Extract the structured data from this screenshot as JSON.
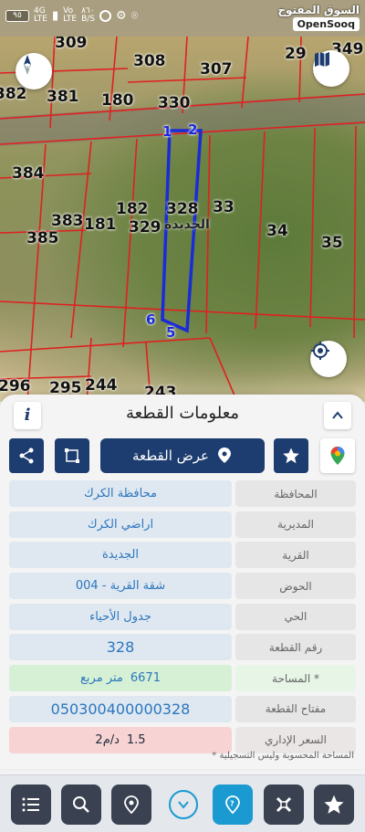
{
  "status_bar": {
    "battery": "٩٥",
    "net_top": "4G",
    "net_bottom": "LTE",
    "vo_top": "Vo",
    "vo_bottom": "LTE",
    "speed_top": "٨٦٠",
    "speed_bottom": "B/S"
  },
  "brand": {
    "arabic": "السوق المفتوح",
    "english": "OpenSooq"
  },
  "map": {
    "plots": [
      {
        "id": "309",
        "pos": "p1"
      },
      {
        "id": "308",
        "pos": "p2"
      },
      {
        "id": "307",
        "pos": "p3"
      },
      {
        "id": "29",
        "pos": "p4"
      },
      {
        "id": "349",
        "pos": "p5"
      },
      {
        "id": "382",
        "pos": "p6"
      },
      {
        "id": "381",
        "pos": "p7"
      },
      {
        "id": "180",
        "pos": "p8"
      },
      {
        "id": "330",
        "pos": "p9"
      },
      {
        "id": "384",
        "pos": "p10"
      },
      {
        "id": "182",
        "pos": "p11"
      },
      {
        "id": "328",
        "pos": "p12"
      },
      {
        "id": "33",
        "pos": "p13"
      },
      {
        "id": "383",
        "pos": "p14"
      },
      {
        "id": "181",
        "pos": "p15"
      },
      {
        "id": "329",
        "pos": "p16"
      },
      {
        "id": "385",
        "pos": "p17"
      },
      {
        "id": "34",
        "pos": "p18"
      },
      {
        "id": "35",
        "pos": "p19"
      },
      {
        "id": "296",
        "pos": "p20"
      },
      {
        "id": "295",
        "pos": "p21"
      },
      {
        "id": "244",
        "pos": "p22"
      },
      {
        "id": "243",
        "pos": "p23"
      }
    ],
    "vertices": [
      "1",
      "2",
      "5",
      "6"
    ],
    "parcel_label": "الجديدة"
  },
  "panel": {
    "title": "معلومات القطعة",
    "view_button": "عرض القطعة",
    "rows": [
      {
        "label": "المحافظة",
        "value": "محافظة الكرك"
      },
      {
        "label": "المديرية",
        "value": "اراضي الكرك"
      },
      {
        "label": "القرية",
        "value": "الجديدة"
      },
      {
        "label": "الحوض",
        "value": "شقة القرية - 004"
      },
      {
        "label": "الحي",
        "value": "جدول الأحياء"
      },
      {
        "label": "رقم القطعة",
        "value": "328"
      },
      {
        "label": "المساحة *",
        "value_number": "6671",
        "value_unit": "متر مربع"
      },
      {
        "label": "مفتاح القطعة",
        "value": "050300400000328"
      },
      {
        "label": "السعر الإداري",
        "value_number": "1.5",
        "value_unit": "د/م2"
      }
    ],
    "footnote": "* المساحة المحسوبة وليس التسجيلية"
  },
  "colors": {
    "primary": "#1d3c6f",
    "accent": "#1a9ad0",
    "value_text": "#2c76bd",
    "parcel_outline": "#1a2bd8",
    "plot_lines": "#e02020",
    "area_bg": "#d5f0d5",
    "price_bg": "#f8d3d3"
  },
  "icons": {
    "bottom_nav": [
      "list-icon",
      "search-icon",
      "location-pin-icon",
      "chevron-down-icon",
      "help-pin-icon",
      "satellite-icon",
      "star-icon"
    ]
  }
}
